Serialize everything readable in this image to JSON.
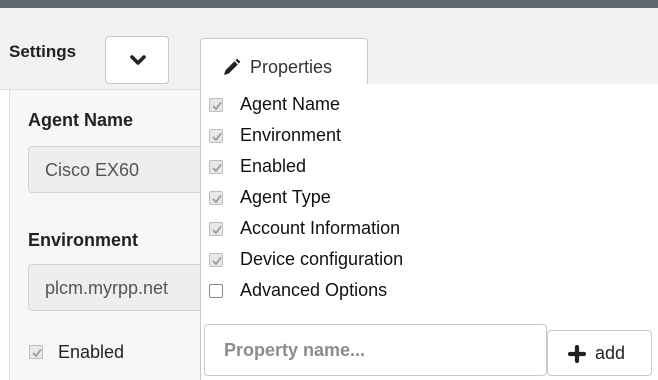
{
  "header": {
    "settings_label": "Settings",
    "properties_label": "Properties",
    "toggle_icon": "chevron-down-icon",
    "properties_icon": "pencil-icon"
  },
  "left_panel": {
    "agent_name_label": "Agent Name",
    "agent_name_value": "Cisco EX60",
    "environment_label": "Environment",
    "environment_value": "plcm.myrpp.net",
    "enabled_label": "Enabled",
    "enabled_checked": true
  },
  "properties_menu": {
    "items": [
      {
        "label": "Agent Name",
        "checked": true
      },
      {
        "label": "Environment",
        "checked": true
      },
      {
        "label": "Enabled",
        "checked": true
      },
      {
        "label": "Agent Type",
        "checked": true
      },
      {
        "label": "Account Information",
        "checked": true
      },
      {
        "label": "Device configuration",
        "checked": true
      },
      {
        "label": "Advanced Options",
        "checked": false
      }
    ],
    "input_placeholder": "Property name...",
    "add_label": "add",
    "add_icon": "plus-icon"
  },
  "colors": {
    "top_bar": "#5c6770",
    "header_bg": "#f1f1f1",
    "checkmark": "#9a9a9a"
  }
}
